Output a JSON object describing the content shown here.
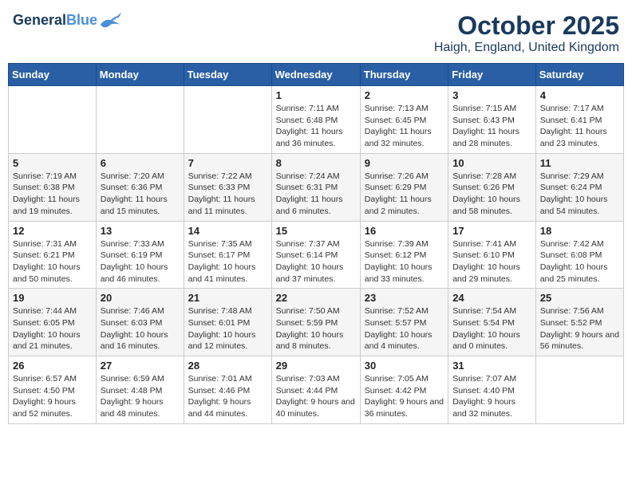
{
  "header": {
    "logo_line1": "General",
    "logo_line2": "Blue",
    "month": "October 2025",
    "location": "Haigh, England, United Kingdom"
  },
  "days_of_week": [
    "Sunday",
    "Monday",
    "Tuesday",
    "Wednesday",
    "Thursday",
    "Friday",
    "Saturday"
  ],
  "weeks": [
    [
      {
        "day": "",
        "sunrise": "",
        "sunset": "",
        "daylight": ""
      },
      {
        "day": "",
        "sunrise": "",
        "sunset": "",
        "daylight": ""
      },
      {
        "day": "",
        "sunrise": "",
        "sunset": "",
        "daylight": ""
      },
      {
        "day": "1",
        "sunrise": "Sunrise: 7:11 AM",
        "sunset": "Sunset: 6:48 PM",
        "daylight": "Daylight: 11 hours and 36 minutes."
      },
      {
        "day": "2",
        "sunrise": "Sunrise: 7:13 AM",
        "sunset": "Sunset: 6:45 PM",
        "daylight": "Daylight: 11 hours and 32 minutes."
      },
      {
        "day": "3",
        "sunrise": "Sunrise: 7:15 AM",
        "sunset": "Sunset: 6:43 PM",
        "daylight": "Daylight: 11 hours and 28 minutes."
      },
      {
        "day": "4",
        "sunrise": "Sunrise: 7:17 AM",
        "sunset": "Sunset: 6:41 PM",
        "daylight": "Daylight: 11 hours and 23 minutes."
      }
    ],
    [
      {
        "day": "5",
        "sunrise": "Sunrise: 7:19 AM",
        "sunset": "Sunset: 6:38 PM",
        "daylight": "Daylight: 11 hours and 19 minutes."
      },
      {
        "day": "6",
        "sunrise": "Sunrise: 7:20 AM",
        "sunset": "Sunset: 6:36 PM",
        "daylight": "Daylight: 11 hours and 15 minutes."
      },
      {
        "day": "7",
        "sunrise": "Sunrise: 7:22 AM",
        "sunset": "Sunset: 6:33 PM",
        "daylight": "Daylight: 11 hours and 11 minutes."
      },
      {
        "day": "8",
        "sunrise": "Sunrise: 7:24 AM",
        "sunset": "Sunset: 6:31 PM",
        "daylight": "Daylight: 11 hours and 6 minutes."
      },
      {
        "day": "9",
        "sunrise": "Sunrise: 7:26 AM",
        "sunset": "Sunset: 6:29 PM",
        "daylight": "Daylight: 11 hours and 2 minutes."
      },
      {
        "day": "10",
        "sunrise": "Sunrise: 7:28 AM",
        "sunset": "Sunset: 6:26 PM",
        "daylight": "Daylight: 10 hours and 58 minutes."
      },
      {
        "day": "11",
        "sunrise": "Sunrise: 7:29 AM",
        "sunset": "Sunset: 6:24 PM",
        "daylight": "Daylight: 10 hours and 54 minutes."
      }
    ],
    [
      {
        "day": "12",
        "sunrise": "Sunrise: 7:31 AM",
        "sunset": "Sunset: 6:21 PM",
        "daylight": "Daylight: 10 hours and 50 minutes."
      },
      {
        "day": "13",
        "sunrise": "Sunrise: 7:33 AM",
        "sunset": "Sunset: 6:19 PM",
        "daylight": "Daylight: 10 hours and 46 minutes."
      },
      {
        "day": "14",
        "sunrise": "Sunrise: 7:35 AM",
        "sunset": "Sunset: 6:17 PM",
        "daylight": "Daylight: 10 hours and 41 minutes."
      },
      {
        "day": "15",
        "sunrise": "Sunrise: 7:37 AM",
        "sunset": "Sunset: 6:14 PM",
        "daylight": "Daylight: 10 hours and 37 minutes."
      },
      {
        "day": "16",
        "sunrise": "Sunrise: 7:39 AM",
        "sunset": "Sunset: 6:12 PM",
        "daylight": "Daylight: 10 hours and 33 minutes."
      },
      {
        "day": "17",
        "sunrise": "Sunrise: 7:41 AM",
        "sunset": "Sunset: 6:10 PM",
        "daylight": "Daylight: 10 hours and 29 minutes."
      },
      {
        "day": "18",
        "sunrise": "Sunrise: 7:42 AM",
        "sunset": "Sunset: 6:08 PM",
        "daylight": "Daylight: 10 hours and 25 minutes."
      }
    ],
    [
      {
        "day": "19",
        "sunrise": "Sunrise: 7:44 AM",
        "sunset": "Sunset: 6:05 PM",
        "daylight": "Daylight: 10 hours and 21 minutes."
      },
      {
        "day": "20",
        "sunrise": "Sunrise: 7:46 AM",
        "sunset": "Sunset: 6:03 PM",
        "daylight": "Daylight: 10 hours and 16 minutes."
      },
      {
        "day": "21",
        "sunrise": "Sunrise: 7:48 AM",
        "sunset": "Sunset: 6:01 PM",
        "daylight": "Daylight: 10 hours and 12 minutes."
      },
      {
        "day": "22",
        "sunrise": "Sunrise: 7:50 AM",
        "sunset": "Sunset: 5:59 PM",
        "daylight": "Daylight: 10 hours and 8 minutes."
      },
      {
        "day": "23",
        "sunrise": "Sunrise: 7:52 AM",
        "sunset": "Sunset: 5:57 PM",
        "daylight": "Daylight: 10 hours and 4 minutes."
      },
      {
        "day": "24",
        "sunrise": "Sunrise: 7:54 AM",
        "sunset": "Sunset: 5:54 PM",
        "daylight": "Daylight: 10 hours and 0 minutes."
      },
      {
        "day": "25",
        "sunrise": "Sunrise: 7:56 AM",
        "sunset": "Sunset: 5:52 PM",
        "daylight": "Daylight: 9 hours and 56 minutes."
      }
    ],
    [
      {
        "day": "26",
        "sunrise": "Sunrise: 6:57 AM",
        "sunset": "Sunset: 4:50 PM",
        "daylight": "Daylight: 9 hours and 52 minutes."
      },
      {
        "day": "27",
        "sunrise": "Sunrise: 6:59 AM",
        "sunset": "Sunset: 4:48 PM",
        "daylight": "Daylight: 9 hours and 48 minutes."
      },
      {
        "day": "28",
        "sunrise": "Sunrise: 7:01 AM",
        "sunset": "Sunset: 4:46 PM",
        "daylight": "Daylight: 9 hours and 44 minutes."
      },
      {
        "day": "29",
        "sunrise": "Sunrise: 7:03 AM",
        "sunset": "Sunset: 4:44 PM",
        "daylight": "Daylight: 9 hours and 40 minutes."
      },
      {
        "day": "30",
        "sunrise": "Sunrise: 7:05 AM",
        "sunset": "Sunset: 4:42 PM",
        "daylight": "Daylight: 9 hours and 36 minutes."
      },
      {
        "day": "31",
        "sunrise": "Sunrise: 7:07 AM",
        "sunset": "Sunset: 4:40 PM",
        "daylight": "Daylight: 9 hours and 32 minutes."
      },
      {
        "day": "",
        "sunrise": "",
        "sunset": "",
        "daylight": ""
      }
    ]
  ]
}
